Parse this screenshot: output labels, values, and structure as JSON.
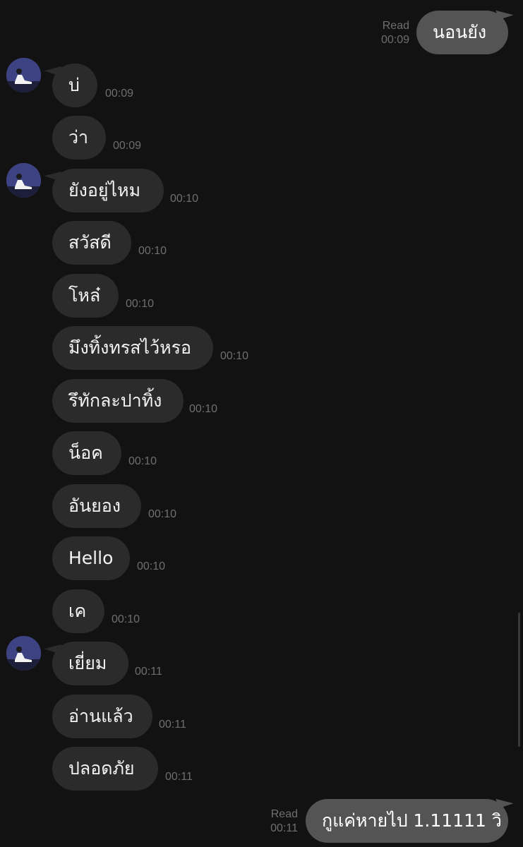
{
  "read_label": "Read",
  "messages": [
    {
      "side": "out",
      "text": "นอนยัง",
      "time": "00:09",
      "read": "Read"
    },
    {
      "side": "in",
      "text": "บ่",
      "time": "00:09",
      "avatar": true
    },
    {
      "side": "in",
      "text": "ว่า",
      "time": "00:09"
    },
    {
      "side": "in",
      "text": "ยังอยู่ไหม",
      "time": "00:10",
      "avatar": true
    },
    {
      "side": "in",
      "text": "สวัสดี",
      "time": "00:10"
    },
    {
      "side": "in",
      "text": "โหล๋",
      "time": "00:10"
    },
    {
      "side": "in",
      "text": "มึงทิ้งทรสไว้หรอ",
      "time": "00:10"
    },
    {
      "side": "in",
      "text": "รึทักละปาทิ้ง",
      "time": "00:10"
    },
    {
      "side": "in",
      "text": "น็อค",
      "time": "00:10"
    },
    {
      "side": "in",
      "text": "อันยอง",
      "time": "00:10"
    },
    {
      "side": "in",
      "text": "Hello",
      "time": "00:10"
    },
    {
      "side": "in",
      "text": "เค",
      "time": "00:10"
    },
    {
      "side": "in",
      "text": "เยี่ยม",
      "time": "00:11",
      "avatar": true
    },
    {
      "side": "in",
      "text": "อ่านแล้ว",
      "time": "00:11"
    },
    {
      "side": "in",
      "text": "ปลอดภัย",
      "time": "00:11"
    },
    {
      "side": "out",
      "text": "กูแค่หายไป 1.11111 วิ",
      "time": "00:11",
      "read": "Read"
    }
  ],
  "colors": {
    "background": "#121212",
    "incoming_bubble": "#2b2b2b",
    "outgoing_bubble": "#545454",
    "timestamp": "#6f6f6f"
  }
}
